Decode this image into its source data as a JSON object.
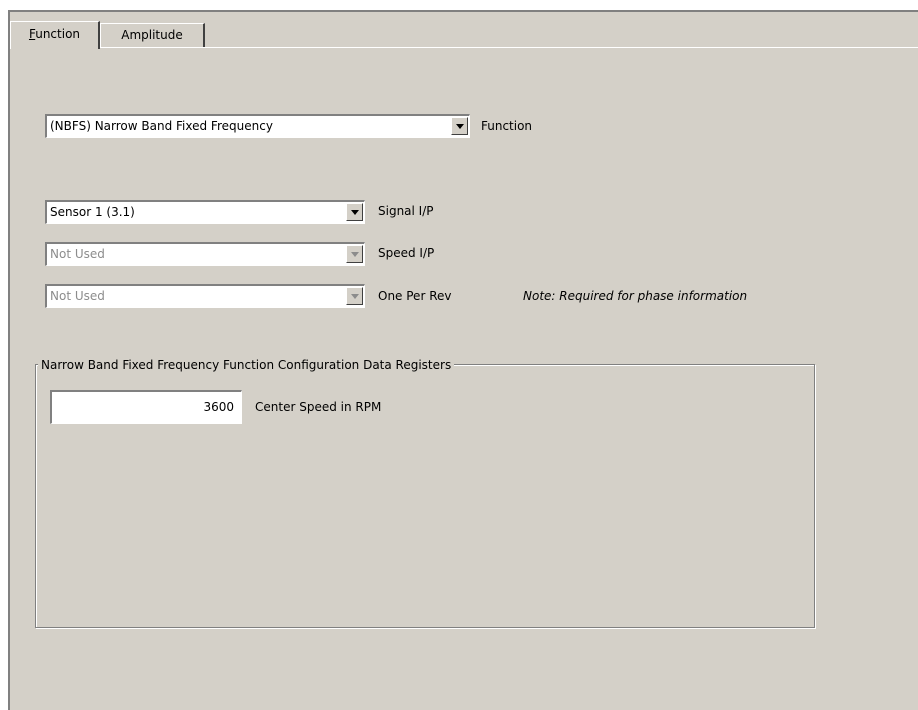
{
  "tabs": [
    {
      "label_first": "F",
      "label_rest": "unction",
      "active": true
    },
    {
      "label": "Amplitude",
      "active": false
    }
  ],
  "function_combo": {
    "value": "(NBFS)  Narrow Band Fixed Frequency",
    "label": "Function"
  },
  "signal_combo": {
    "value": "Sensor 1 (3.1)",
    "label": "Signal I/P"
  },
  "speed_combo": {
    "value": "Not Used",
    "label": "Speed I/P",
    "disabled": true
  },
  "onceperrev_combo": {
    "value": "Not Used",
    "label": "One Per Rev",
    "disabled": true
  },
  "note": "Note: Required for phase information",
  "group": {
    "title": "Narrow Band Fixed Frequency Function Configuration Data Registers",
    "center_speed_value": "3600",
    "center_speed_label": "Center Speed in RPM"
  },
  "icons": {
    "dropdown": "chevron-down-icon"
  }
}
